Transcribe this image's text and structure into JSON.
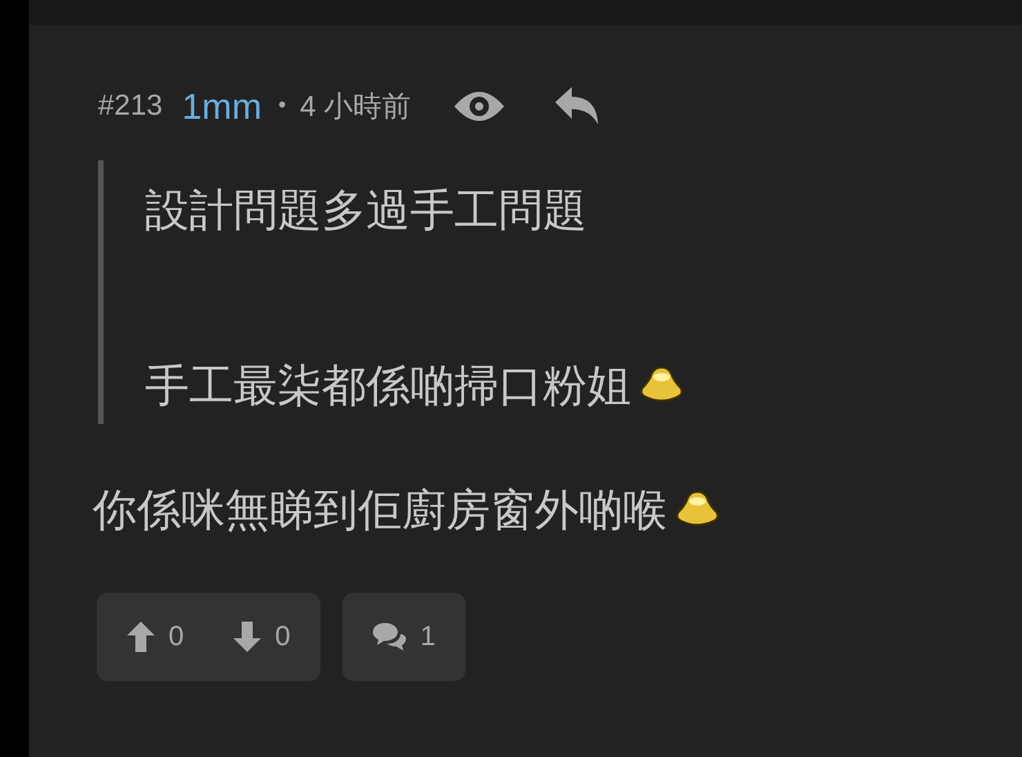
{
  "post": {
    "number": "#213",
    "author": "1mm",
    "separator": "•",
    "time": "4 小時前"
  },
  "quote": [
    "設計問題多過手工問題",
    "手工最柒都係啲掃口粉姐"
  ],
  "quote_emoji": [
    false,
    true
  ],
  "body": "你係咪無睇到佢廚房窗外啲喉",
  "body_emoji": true,
  "votes": {
    "up": "0",
    "down": "0"
  },
  "comments": "1"
}
